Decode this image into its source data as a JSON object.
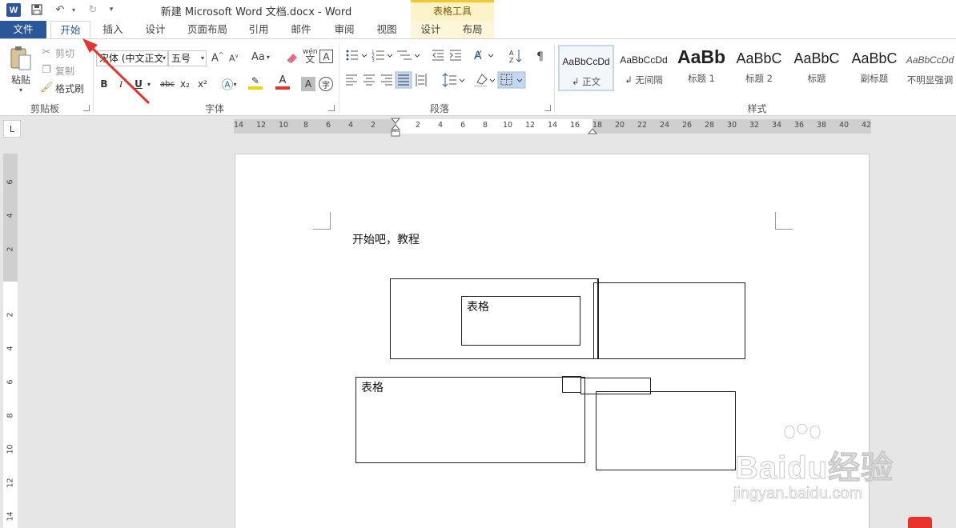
{
  "titlebar": {
    "app_icon": "W",
    "title": "新建 Microsoft Word 文档.docx - Word",
    "context_group": "表格工具"
  },
  "tabs": [
    {
      "label": "文件"
    },
    {
      "label": "开始"
    },
    {
      "label": "插入"
    },
    {
      "label": "设计"
    },
    {
      "label": "页面布局"
    },
    {
      "label": "引用"
    },
    {
      "label": "邮件"
    },
    {
      "label": "审阅"
    },
    {
      "label": "视图"
    },
    {
      "label": "设计"
    },
    {
      "label": "布局"
    }
  ],
  "clipboard": {
    "paste": "粘贴",
    "cut": "剪切",
    "copy": "复制",
    "format_painter": "格式刷",
    "group_label": "剪贴板"
  },
  "font": {
    "font_name": "宋体 (中文正文",
    "font_size": "五号",
    "case_label": "Aa",
    "phonetic_label": "wén",
    "group_label": "字体",
    "bold": "B",
    "italic": "I",
    "underline": "U",
    "strike": "abc",
    "subscript": "x₂",
    "superscript": "x²",
    "char_border": "A",
    "char_shade": "A",
    "enclose": "字"
  },
  "paragraph": {
    "group_label": "段落"
  },
  "styles": {
    "group_label": "样式",
    "items": [
      {
        "sample": "AaBbCcDd",
        "name": "正文"
      },
      {
        "sample": "AaBbCcDd",
        "name": "无间隔"
      },
      {
        "sample": "AaBb",
        "name": "标题 1"
      },
      {
        "sample": "AaBbC",
        "name": "标题 2"
      },
      {
        "sample": "AaBbC",
        "name": "标题"
      },
      {
        "sample": "AaBbC",
        "name": "副标题"
      },
      {
        "sample": "AaBbCcDd",
        "name": "不明显强调"
      }
    ]
  },
  "ruler": {
    "selector": "L",
    "h_ticks": [
      "14",
      "12",
      "10",
      "8",
      "6",
      "4",
      "2",
      "2",
      "4",
      "6",
      "8",
      "10",
      "12",
      "14",
      "16",
      "18",
      "20",
      "22",
      "24",
      "26",
      "28",
      "30",
      "32",
      "34",
      "36",
      "38",
      "40",
      "42"
    ],
    "v_ticks": [
      "6",
      "4",
      "2",
      "2",
      "4",
      "6",
      "8",
      "10",
      "12",
      "14"
    ]
  },
  "document": {
    "first_line": "开始吧，教程",
    "shape_text_1": "表格",
    "shape_text_2": "表格"
  },
  "watermark": {
    "brand": "Baidu经验",
    "url": "jingyan.baidu.com"
  },
  "colors": {
    "file_tab": "#2b579a",
    "accent": "#2b579a",
    "context_tab": "#f3c52e",
    "arrow": "#e8322c",
    "highlight": "#f2d200",
    "font_color": "#e8322c"
  }
}
